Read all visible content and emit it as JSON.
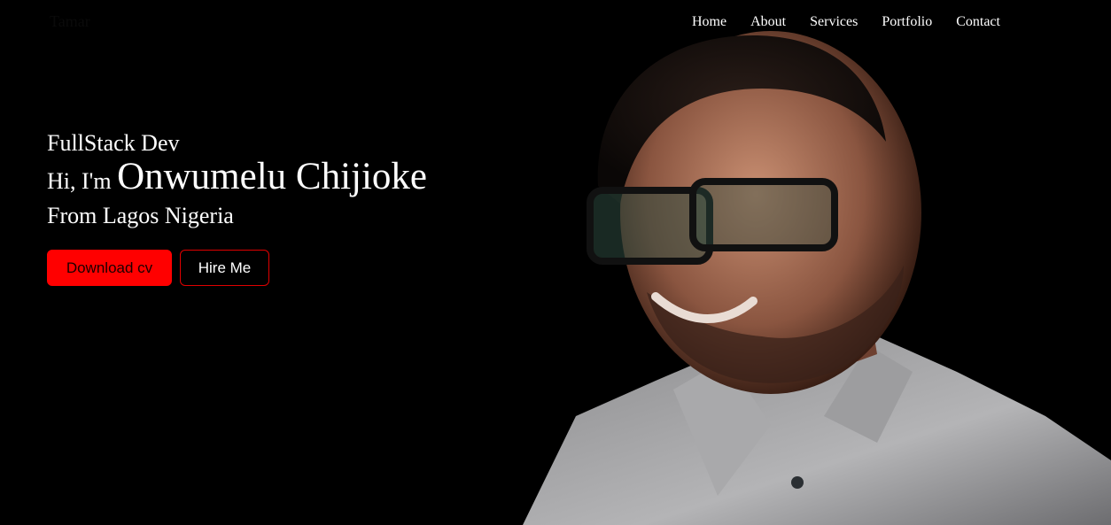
{
  "nav": {
    "logo": "Tamar",
    "links": [
      "Home",
      "About",
      "Services",
      "Portfolio",
      "Contact"
    ]
  },
  "hero": {
    "role": "FullStack Dev",
    "greeting": "Hi, I'm",
    "name": "Onwumelu Chijioke",
    "location": "From Lagos Nigeria",
    "buttons": {
      "download": "Download cv",
      "hire": "Hire Me"
    }
  },
  "colors": {
    "accent": "#ff0000",
    "background": "#000000",
    "text": "#ffffff"
  }
}
